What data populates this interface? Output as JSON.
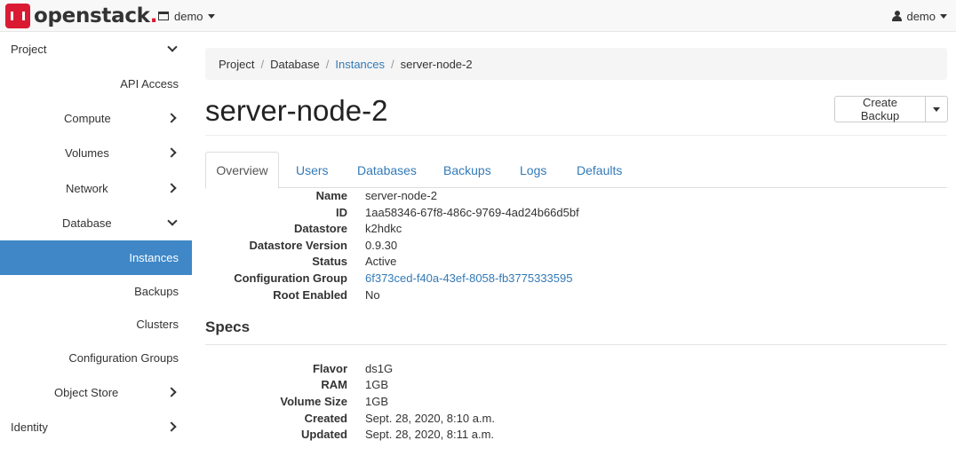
{
  "brand": {
    "name": "openstack",
    "dot": "."
  },
  "navbar": {
    "project": "demo",
    "user": "demo"
  },
  "sidebar": {
    "items": [
      {
        "label": "Project",
        "chevron": "down"
      },
      {
        "label": "API Access",
        "chevron": ""
      },
      {
        "label": "Compute",
        "chevron": "right"
      },
      {
        "label": "Volumes",
        "chevron": "right"
      },
      {
        "label": "Network",
        "chevron": "right"
      },
      {
        "label": "Database",
        "chevron": "down"
      },
      {
        "label": "Instances",
        "chevron": "",
        "active": true
      },
      {
        "label": "Backups",
        "chevron": ""
      },
      {
        "label": "Clusters",
        "chevron": ""
      },
      {
        "label": "Configuration Groups",
        "chevron": ""
      },
      {
        "label": "Object Store",
        "chevron": "right"
      },
      {
        "label": "Identity",
        "chevron": "right"
      }
    ]
  },
  "breadcrumb": [
    "Project",
    "Database",
    "Instances",
    "server-node-2"
  ],
  "page": {
    "title": "server-node-2",
    "create_backup": "Create Backup"
  },
  "tabs": [
    "Overview",
    "Users",
    "Databases",
    "Backups",
    "Logs",
    "Defaults"
  ],
  "overview": [
    {
      "label": "Name",
      "value": "server-node-2"
    },
    {
      "label": "ID",
      "value": "1aa58346-67f8-486c-9769-4ad24b66d5bf"
    },
    {
      "label": "Datastore",
      "value": "k2hdkc"
    },
    {
      "label": "Datastore Version",
      "value": "0.9.30"
    },
    {
      "label": "Status",
      "value": "Active"
    },
    {
      "label": "Configuration Group",
      "value": "6f373ced-f40a-43ef-8058-fb3775333595"
    },
    {
      "label": "Root Enabled",
      "value": "No"
    }
  ],
  "specs": {
    "title": "Specs",
    "items": [
      {
        "label": "Flavor",
        "value": "ds1G"
      },
      {
        "label": "RAM",
        "value": "1GB"
      },
      {
        "label": "Volume Size",
        "value": "1GB"
      },
      {
        "label": "Created",
        "value": "Sept. 28, 2020, 8:10 a.m."
      },
      {
        "label": "Updated",
        "value": "Sept. 28, 2020, 8:11 a.m."
      }
    ]
  },
  "colors": {
    "accent": "#3f87c7",
    "link": "#337ab7",
    "brand": "#da1a32"
  }
}
